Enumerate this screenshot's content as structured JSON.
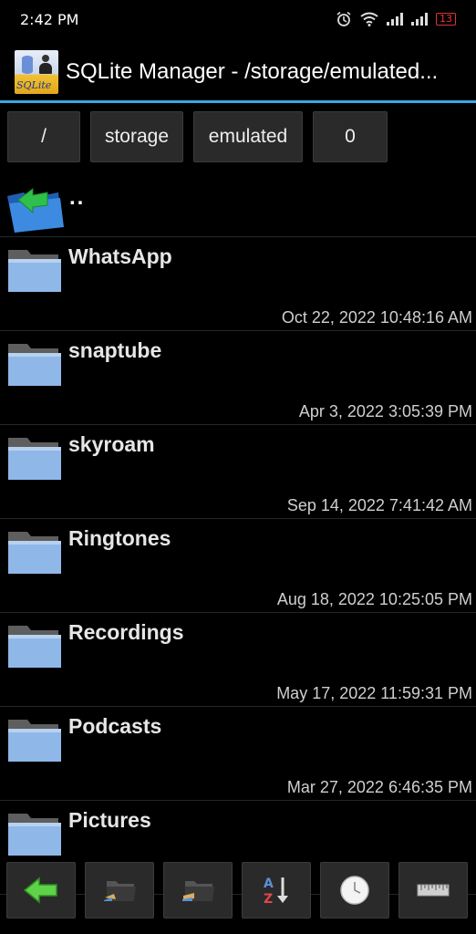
{
  "status": {
    "time": "2:42 PM",
    "battery": "13"
  },
  "header": {
    "title": "SQLite Manager - /storage/emulated...",
    "logo_text": "SQLite"
  },
  "breadcrumbs": [
    "/",
    "storage",
    "emulated",
    "0"
  ],
  "parent_label": "..",
  "folders": [
    {
      "name": "WhatsApp",
      "date": "Oct 22, 2022 10:48:16 AM"
    },
    {
      "name": "snaptube",
      "date": "Apr 3, 2022 3:05:39 PM"
    },
    {
      "name": "skyroam",
      "date": "Sep 14, 2022 7:41:42 AM"
    },
    {
      "name": "Ringtones",
      "date": "Aug 18, 2022 10:25:05 PM"
    },
    {
      "name": "Recordings",
      "date": "May 17, 2022 11:59:31 PM"
    },
    {
      "name": "Podcasts",
      "date": "Mar 27, 2022 6:46:35 PM"
    },
    {
      "name": "Pictures",
      "date": ""
    }
  ],
  "toolbar": [
    "back-arrow-icon",
    "folder-new-icon",
    "folder-open-icon",
    "sort-az-icon",
    "clock-icon",
    "ruler-icon"
  ],
  "colors": {
    "accent": "#35a8e0",
    "folder": "#8fb8e8"
  }
}
